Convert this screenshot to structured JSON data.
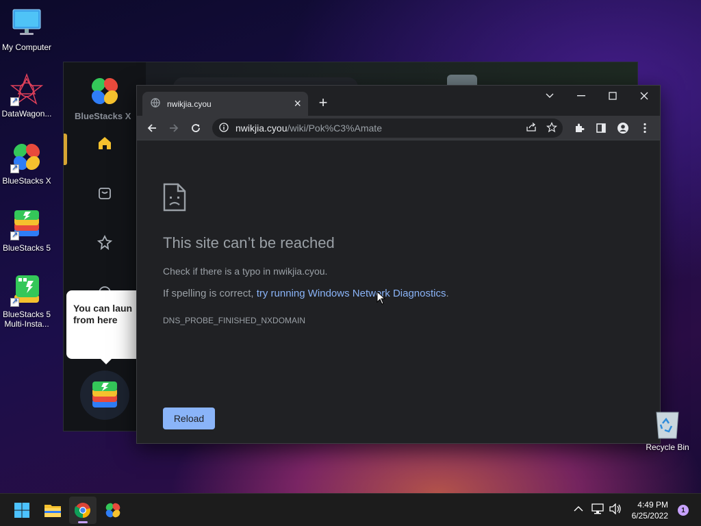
{
  "desktop": {
    "icons": [
      {
        "label": "My Computer",
        "icon": "monitor-icon"
      },
      {
        "label": "DataWagon...",
        "icon": "datawagon-icon"
      },
      {
        "label": "BlueStacks X",
        "icon": "bluestacks-x-icon"
      },
      {
        "label": "BlueStacks 5",
        "icon": "bluestacks-5-icon"
      },
      {
        "label": "BlueStacks 5 Multi-Insta...",
        "icon": "bluestacks-multi-instance-icon"
      }
    ],
    "recycle_bin": {
      "label": "Recycle Bin",
      "icon": "recycle-bin-icon"
    }
  },
  "bluestacks": {
    "brand": "BlueStacks X",
    "tooltip": "You can laun from here",
    "nav": [
      "home-icon",
      "store-icon",
      "games-icon",
      "chat-icon"
    ]
  },
  "chrome": {
    "tab": {
      "title": "nwikjia.cyou",
      "close": "×"
    },
    "new_tab": "+",
    "window_controls": [
      "chevron-down-icon",
      "minimize-icon",
      "maximize-icon",
      "close-icon"
    ],
    "omnibox": {
      "host": "nwikjia.cyou",
      "path": "/wiki/Pok%C3%Amate"
    },
    "error": {
      "heading": "This site can’t be reached",
      "line1": "Check if there is a typo in nwikjia.cyou.",
      "line2_prefix": "If spelling is correct, ",
      "line2_link": "try running Windows Network Diagnostics",
      "line2_suffix": ".",
      "code": "DNS_PROBE_FINISHED_NXDOMAIN",
      "reload_label": "Reload"
    }
  },
  "taskbar": {
    "apps": [
      "windows-start-icon",
      "file-explorer-icon",
      "chrome-icon",
      "bluestacks-x-icon"
    ],
    "active_app": "chrome-icon",
    "time": "4:49 PM",
    "date": "6/25/2022",
    "notification_count": "1"
  },
  "colors": {
    "accent_link": "#8ab4f8",
    "chrome_bg": "#202124",
    "toolbar_bg": "#35363a",
    "taskbar_bg": "#1c1c1c"
  }
}
